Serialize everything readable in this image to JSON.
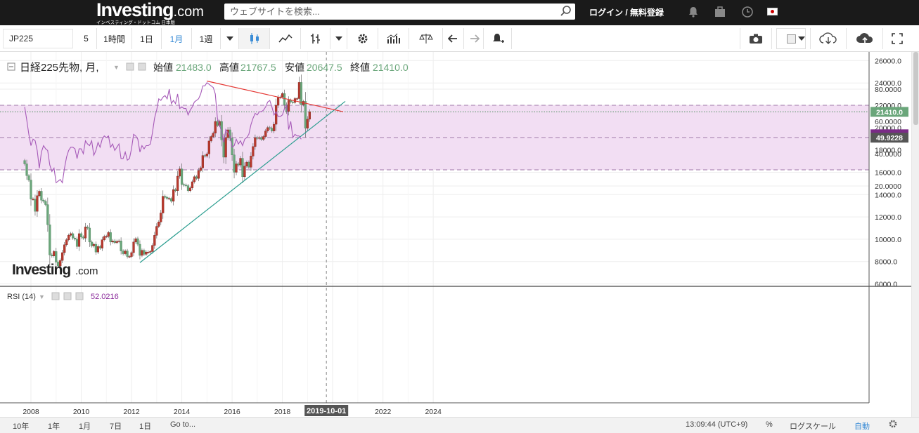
{
  "header": {
    "logo": "Investing",
    "logo_domain": ".com",
    "logo_sub": "インベスティング・ドットコム 日本版",
    "search_placeholder": "ウェブサイトを検索...",
    "login": "ログイン / 無料登録"
  },
  "toolbar": {
    "symbol": "JP225",
    "intervals": [
      "5",
      "1時間",
      "1日",
      "1月",
      "1週"
    ],
    "active_interval": "1月"
  },
  "legend": {
    "title": "日経225先物, 月,",
    "open_label": "始値",
    "open_value": "21483.0",
    "high_label": "高値",
    "high_value": "21767.5",
    "low_label": "安値",
    "low_value": "20647.5",
    "close_label": "終値",
    "close_value": "21410.0"
  },
  "rsi_legend": {
    "label": "RSI (14)",
    "value": "52.0216"
  },
  "watermark": {
    "brand": "Investing",
    "domain": ".com"
  },
  "colors": {
    "up": "#b93a2e",
    "down": "#6aa67a",
    "trendline": "#2a9d8f",
    "rsi_line": "#a65ab8",
    "rsi_band": "#f2def3",
    "divergence": "#e53935"
  },
  "bottombar": {
    "ranges": [
      "10年",
      "1年",
      "1月",
      "7日",
      "1日",
      "Go to..."
    ],
    "time": "13:09:44 (UTC+9)",
    "percent": "%",
    "log": "ログスケール",
    "auto": "自動"
  },
  "chart_data": [
    {
      "type": "candlestick",
      "title": "日経225先物, 月,",
      "x": [
        "2007-10",
        "2007-11",
        "2007-12",
        "2008-01",
        "2008-02",
        "2008-03",
        "2008-04",
        "2008-05",
        "2008-06",
        "2008-07",
        "2008-08",
        "2008-09",
        "2008-10",
        "2008-11",
        "2008-12",
        "2009-01",
        "2009-02",
        "2009-03",
        "2009-04",
        "2009-05",
        "2009-06",
        "2009-07",
        "2009-08",
        "2009-09",
        "2009-10",
        "2009-11",
        "2009-12",
        "2010-01",
        "2010-02",
        "2010-03",
        "2010-04",
        "2010-05",
        "2010-06",
        "2010-07",
        "2010-08",
        "2010-09",
        "2010-10",
        "2010-11",
        "2010-12",
        "2011-01",
        "2011-02",
        "2011-03",
        "2011-04",
        "2011-05",
        "2011-06",
        "2011-07",
        "2011-08",
        "2011-09",
        "2011-10",
        "2011-11",
        "2011-12",
        "2012-01",
        "2012-02",
        "2012-03",
        "2012-04",
        "2012-05",
        "2012-06",
        "2012-07",
        "2012-08",
        "2012-09",
        "2012-10",
        "2012-11",
        "2012-12",
        "2013-01",
        "2013-02",
        "2013-03",
        "2013-04",
        "2013-05",
        "2013-06",
        "2013-07",
        "2013-08",
        "2013-09",
        "2013-10",
        "2013-11",
        "2013-12",
        "2014-01",
        "2014-02",
        "2014-03",
        "2014-04",
        "2014-05",
        "2014-06",
        "2014-07",
        "2014-08",
        "2014-09",
        "2014-10",
        "2014-11",
        "2014-12",
        "2015-01",
        "2015-02",
        "2015-03",
        "2015-04",
        "2015-05",
        "2015-06",
        "2015-07",
        "2015-08",
        "2015-09",
        "2015-10",
        "2015-11",
        "2015-12",
        "2016-01",
        "2016-02",
        "2016-03",
        "2016-04",
        "2016-05",
        "2016-06",
        "2016-07",
        "2016-08",
        "2016-09",
        "2016-10",
        "2016-11",
        "2016-12",
        "2017-01",
        "2017-02",
        "2017-03",
        "2017-04",
        "2017-05",
        "2017-06",
        "2017-07",
        "2017-08",
        "2017-09",
        "2017-10",
        "2017-11",
        "2017-12",
        "2018-01",
        "2018-02",
        "2018-03",
        "2018-04",
        "2018-05",
        "2018-06",
        "2018-07",
        "2018-08",
        "2018-09",
        "2018-10",
        "2018-11",
        "2018-12",
        "2019-01",
        "2019-02"
      ],
      "close": [
        16750,
        15700,
        15300,
        13600,
        13600,
        12500,
        13900,
        14300,
        13500,
        13400,
        13100,
        11300,
        8600,
        8500,
        8900,
        7950,
        7600,
        8100,
        8800,
        9500,
        9950,
        10350,
        10500,
        10100,
        10000,
        9350,
        10500,
        10200,
        10100,
        11100,
        11000,
        9750,
        9400,
        9550,
        8850,
        9350,
        9200,
        9950,
        10250,
        10250,
        10600,
        9750,
        9850,
        9700,
        9800,
        9850,
        8950,
        8700,
        8950,
        8450,
        8450,
        8800,
        9750,
        10050,
        9550,
        8550,
        9000,
        8650,
        8850,
        8850,
        8900,
        9450,
        10350,
        11150,
        11550,
        12350,
        13850,
        13750,
        13650,
        13650,
        13400,
        14450,
        14350,
        15650,
        16300,
        14900,
        14850,
        14800,
        14350,
        14600,
        15150,
        15600,
        15450,
        16150,
        16400,
        17500,
        17450,
        17650,
        18800,
        19200,
        19500,
        20550,
        20200,
        20550,
        18900,
        17350,
        19100,
        19800,
        19050,
        17550,
        16000,
        16750,
        16650,
        17250,
        15600,
        16550,
        16900,
        16450,
        17450,
        18300,
        19100,
        19050,
        19100,
        18950,
        19200,
        19700,
        20000,
        19950,
        19700,
        20300,
        22000,
        22700,
        22750,
        23050,
        22050,
        21450,
        22450,
        22300,
        22250,
        22600,
        22600,
        24050,
        22050,
        22350,
        19950,
        20750,
        21410
      ],
      "yrange": [
        6000,
        26000
      ],
      "current_price": "21410.0"
    },
    {
      "type": "line",
      "name": "RSI (14)",
      "x": [
        "2007-10",
        "2007-11",
        "2007-12",
        "2008-01",
        "2008-02",
        "2008-03",
        "2008-04",
        "2008-05",
        "2008-06",
        "2008-07",
        "2008-08",
        "2008-09",
        "2008-10",
        "2008-11",
        "2008-12",
        "2009-01",
        "2009-02",
        "2009-03",
        "2009-04",
        "2009-05",
        "2009-06",
        "2009-07",
        "2009-08",
        "2009-09",
        "2009-10",
        "2009-11",
        "2009-12",
        "2010-01",
        "2010-02",
        "2010-03",
        "2010-04",
        "2010-05",
        "2010-06",
        "2010-07",
        "2010-08",
        "2010-09",
        "2010-10",
        "2010-11",
        "2010-12",
        "2011-01",
        "2011-02",
        "2011-03",
        "2011-04",
        "2011-05",
        "2011-06",
        "2011-07",
        "2011-08",
        "2011-09",
        "2011-10",
        "2011-11",
        "2011-12",
        "2012-01",
        "2012-02",
        "2012-03",
        "2012-04",
        "2012-05",
        "2012-06",
        "2012-07",
        "2012-08",
        "2012-09",
        "2012-10",
        "2012-11",
        "2012-12",
        "2013-01",
        "2013-02",
        "2013-03",
        "2013-04",
        "2013-05",
        "2013-06",
        "2013-07",
        "2013-08",
        "2013-09",
        "2013-10",
        "2013-11",
        "2013-12",
        "2014-01",
        "2014-02",
        "2014-03",
        "2014-04",
        "2014-05",
        "2014-06",
        "2014-07",
        "2014-08",
        "2014-09",
        "2014-10",
        "2014-11",
        "2014-12",
        "2015-01",
        "2015-02",
        "2015-03",
        "2015-04",
        "2015-05",
        "2015-06",
        "2015-07",
        "2015-08",
        "2015-09",
        "2015-10",
        "2015-11",
        "2015-12",
        "2016-01",
        "2016-02",
        "2016-03",
        "2016-04",
        "2016-05",
        "2016-06",
        "2016-07",
        "2016-08",
        "2016-09",
        "2016-10",
        "2016-11",
        "2016-12",
        "2017-01",
        "2017-02",
        "2017-03",
        "2017-04",
        "2017-05",
        "2017-06",
        "2017-07",
        "2017-08",
        "2017-09",
        "2017-10",
        "2017-11",
        "2017-12",
        "2018-01",
        "2018-02",
        "2018-03",
        "2018-04",
        "2018-05",
        "2018-06",
        "2018-07",
        "2018-08",
        "2018-09",
        "2018-10",
        "2018-11",
        "2018-12",
        "2019-01",
        "2019-02"
      ],
      "y": [
        69,
        61,
        52,
        45,
        49,
        48,
        42,
        31,
        41,
        45,
        43,
        42,
        33,
        29,
        31,
        22,
        23,
        24,
        22,
        31,
        38,
        42,
        44,
        44,
        43,
        37,
        43,
        43,
        40,
        48,
        46,
        45,
        48,
        39,
        42,
        47,
        44,
        49,
        51,
        50,
        51,
        44,
        46,
        42,
        44,
        46,
        37,
        37,
        41,
        36,
        37,
        43,
        52,
        51,
        49,
        41,
        45,
        43,
        45,
        45,
        46,
        53,
        62,
        67,
        74,
        73,
        75,
        76,
        74,
        80,
        71,
        73,
        71,
        77,
        68,
        69,
        68,
        68,
        64,
        67,
        69,
        72,
        73,
        74,
        77,
        82,
        82,
        84,
        83,
        82,
        81,
        77,
        62,
        58,
        53,
        47,
        55,
        53,
        51,
        44,
        45,
        49,
        46,
        48,
        45,
        49,
        50,
        52,
        58,
        62,
        65,
        64,
        66,
        66,
        67,
        69,
        72,
        73,
        69,
        64,
        66,
        63,
        63,
        64,
        68,
        70,
        55,
        60,
        50,
        52,
        51,
        51,
        49
      ],
      "yrange": [
        20,
        85
      ],
      "levels": [
        70,
        50,
        30
      ],
      "current_value": "49.9228"
    }
  ],
  "axes": {
    "price_ticks": [
      "26000.0",
      "24000.0",
      "22000.0",
      "20000.0",
      "18000.0",
      "16000.0",
      "14000.0",
      "12000.0",
      "10000.0",
      "8000.0",
      "6000.0"
    ],
    "rsi_ticks": [
      "80.0000",
      "60.0000",
      "40.0000",
      "20.0000"
    ],
    "year_ticks": [
      "2008",
      "2010",
      "2012",
      "2014",
      "2016",
      "2018",
      "2020",
      "2022",
      "2024"
    ],
    "date_cursor": "2019-10-01"
  }
}
